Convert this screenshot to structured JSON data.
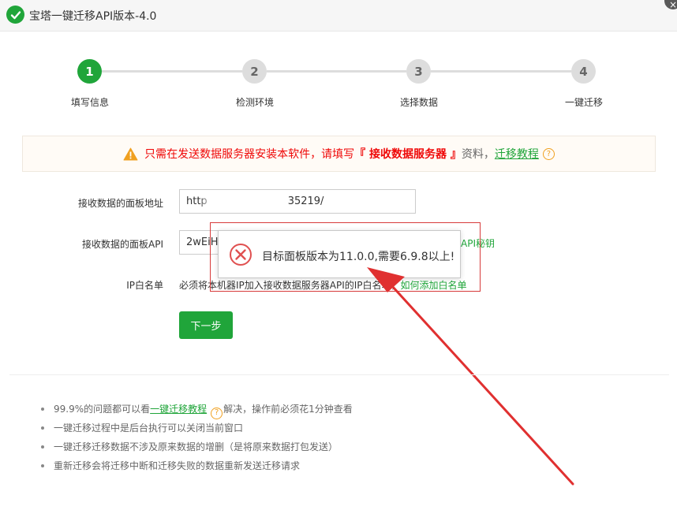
{
  "window": {
    "title": "宝塔一键迁移API版本-4.0",
    "close_label": "×"
  },
  "steps": [
    {
      "num": "1",
      "label": "填写信息"
    },
    {
      "num": "2",
      "label": "检测环境"
    },
    {
      "num": "3",
      "label": "选择数据"
    },
    {
      "num": "4",
      "label": "一键迁移"
    }
  ],
  "notice": {
    "text_before": "只需在发送数据服务器安装本软件，请填写",
    "highlight": "『 接收数据服务器 』",
    "text_after": "资料，",
    "link": "迁移教程",
    "help": "?"
  },
  "form": {
    "panel_address_label": "接收数据的面板地址",
    "panel_address_value": "http",
    "panel_address_suffix": "35219/",
    "panel_api_label": "接收数据的面板API",
    "panel_api_value": "2wEiHl",
    "api_secret_link": "API秘钥",
    "ip_whitelist_label": "IP白名单",
    "ip_whitelist_text": "必须将本机器IP加入接收数据服务器API的IP白名单，",
    "ip_whitelist_link": "如何添加白名单"
  },
  "buttons": {
    "next": "下一步"
  },
  "error_dialog": {
    "message": "目标面板版本为11.0.0,需要6.9.8以上!"
  },
  "tips": {
    "t1_before": "99.9%的问题都可以看",
    "t1_link": "一键迁移教程",
    "t1_help": "?",
    "t1_after": "解决，操作前必须花1分钟查看",
    "t2": "一键迁移过程中是后台执行可以关闭当前窗口",
    "t3": "一键迁移迁移数据不涉及原来数据的增删（是将原来数据打包发送）",
    "t4": "重新迁移会将迁移中断和迁移失败的数据重新发送迁移请求"
  },
  "colors": {
    "brand_green": "#20a53a",
    "warning_red": "#ef0808",
    "annotation_red": "#e03030"
  }
}
